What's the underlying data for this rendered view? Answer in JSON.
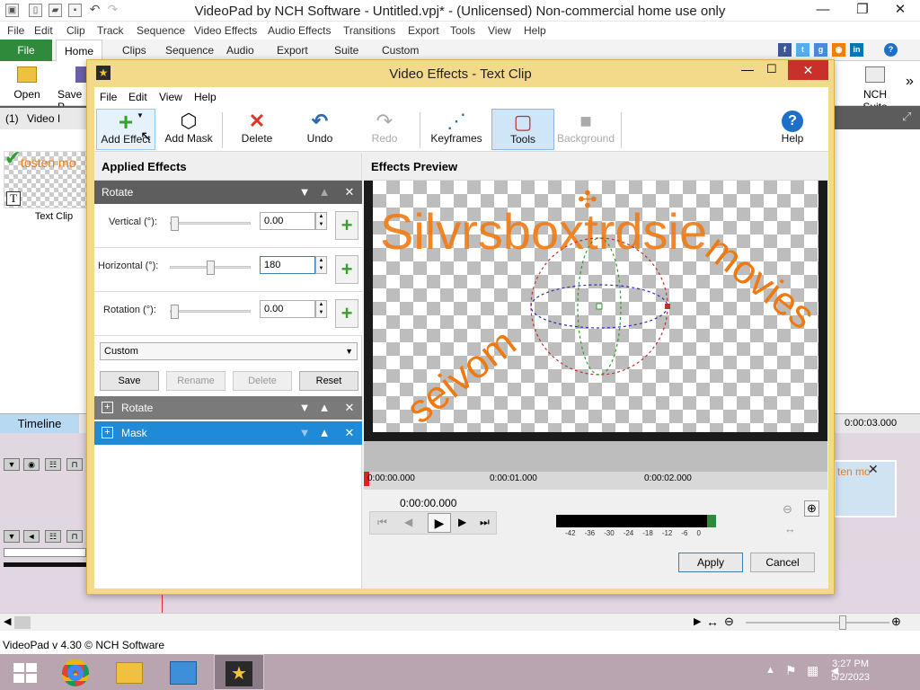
{
  "window": {
    "title": "VideoPad by NCH Software - Untitled.vpj* - (Unlicensed) Non-commercial home use only",
    "controls": [
      "—",
      "❐",
      "✕"
    ]
  },
  "menu": [
    "File",
    "Edit",
    "Clip",
    "Track",
    "Sequence",
    "Video Effects",
    "Audio Effects",
    "Transitions",
    "Export",
    "Tools",
    "View",
    "Help"
  ],
  "ribbon": {
    "tabs": [
      "File",
      "Home",
      "Clips",
      "Sequence",
      "Audio",
      "Export",
      "Suite",
      "Custom"
    ],
    "buttons": {
      "open": "Open",
      "save": "Save P",
      "nch_suite": "NCH Suite"
    },
    "social": [
      "f",
      "t",
      "g",
      "in"
    ],
    "help": "?"
  },
  "bin": {
    "tab_count": "(1)",
    "tab_label": "Video I",
    "clip_label": "Text Clip",
    "clip_text": "tosten mo"
  },
  "timeline": {
    "tab": "Timeline",
    "end_time": "0:00:03.000",
    "overlay_text": "ten mo"
  },
  "status": {
    "text": "VideoPad v 4.30 © NCH Software"
  },
  "taskbar": {
    "time": "3:27 PM",
    "date": "5/2/2023"
  },
  "dialog": {
    "title": "Video Effects - Text Clip",
    "menu": [
      "File",
      "Edit",
      "View",
      "Help"
    ],
    "toolbar": [
      {
        "label": "Add Effect",
        "icon": "+",
        "name": "add-effect"
      },
      {
        "label": "Add Mask",
        "icon": "⬡",
        "name": "add-mask"
      },
      {
        "label": "Delete",
        "icon": "✕",
        "name": "delete"
      },
      {
        "label": "Undo",
        "icon": "↶",
        "name": "undo"
      },
      {
        "label": "Redo",
        "icon": "↷",
        "name": "redo"
      },
      {
        "label": "Keyframes",
        "icon": "⋰",
        "name": "keyframes"
      },
      {
        "label": "Tools",
        "icon": "▢",
        "name": "tools"
      },
      {
        "label": "Background",
        "icon": "■",
        "name": "background"
      },
      {
        "label": "Help",
        "icon": "?",
        "name": "help"
      }
    ],
    "applied_header": "Applied Effects",
    "rotate_header": "Rotate",
    "params": [
      {
        "label": "Vertical (°):",
        "value": "0.00"
      },
      {
        "label": "Horizontal (°):",
        "value": "180"
      },
      {
        "label": "Rotation (°):",
        "value": "0.00"
      }
    ],
    "preset": "Custom",
    "preset_buttons": [
      "Save",
      "Rename",
      "Delete",
      "Reset"
    ],
    "effect_list": [
      "Rotate",
      "Mask"
    ],
    "preview_header": "Effects Preview",
    "preview_texts": {
      "line": "Silvrsboxtrdsie",
      "arc_left": "seivom",
      "arc_right": "movies"
    },
    "ruler": [
      "0:00:00.000",
      "0:00:01.000",
      "0:00:02.000"
    ],
    "timecode": "0:00:00.000",
    "meter_ticks": [
      "-42",
      "-36",
      "-30",
      "-24",
      "-18",
      "-12",
      "-6",
      "0"
    ],
    "apply": "Apply",
    "cancel": "Cancel"
  }
}
